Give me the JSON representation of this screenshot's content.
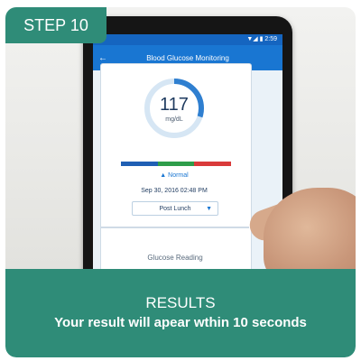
{
  "step_label": "STEP 10",
  "phone": {
    "status_time": "▼◢ ▮ 2:59",
    "app_title": "Blood Glucose Monitoring",
    "reading_value": "117",
    "reading_unit": "mg/dL",
    "ring_fraction": 0.3,
    "status_text": "▲ Normal",
    "timestamp": "Sep 30, 2016 02:48 PM",
    "meal_select": "Post Lunch",
    "section_label": "Glucose Reading",
    "range_colors": [
      "#1f5fb4",
      "#2e9d4a",
      "#d93a3a"
    ]
  },
  "banner": {
    "title": "RESULTS",
    "subtitle": "Your result will apear wthin 10 seconds"
  },
  "colors": {
    "accent": "#2f8c78",
    "app_blue": "#1976d2"
  }
}
